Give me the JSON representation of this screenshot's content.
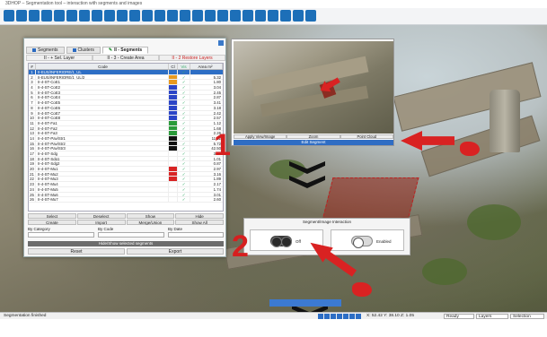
{
  "window": {
    "title": "3DHOP – Segmentation tool – interaction with segments and images"
  },
  "toolbar": {
    "icons": [
      "open-icon",
      "save-icon",
      "layers-icon",
      "folder-icon",
      "cube-icon",
      "target-icon",
      "gear-icon",
      "grid-icon",
      "image-icon",
      "person-icon",
      "lasso-icon",
      "table-icon",
      "pencil-icon",
      "eye-icon",
      "camera-icon",
      "measure-icon",
      "rotate-icon",
      "color-icon",
      "screenshot-icon",
      "palette-icon",
      "compare-icon",
      "brush-icon",
      "search-icon",
      "doc-icon",
      "play-icon"
    ]
  },
  "panel": {
    "tabs": [
      "Segments",
      "Clusters",
      "II - Segments"
    ],
    "subbar": [
      "II - + Sel. Layer",
      "II - 3 - Create Area",
      "II - 2  Restore Layers"
    ],
    "columns": [
      "#",
      "Code",
      "Cl",
      "Vis",
      "Area m²"
    ],
    "rows": [
      {
        "n": "1",
        "code": "II-EUS/INFERIORE/1_UL",
        "color": "#2d6ec5",
        "vis": "✓",
        "area": "",
        "selected": true
      },
      {
        "n": "2",
        "code": "II-EUS/INFERIORE/1_UL/2",
        "color": "#e89a1e",
        "vis": "✓",
        "area": "5.32"
      },
      {
        "n": "3",
        "code": "II-4-ST-CoE1",
        "color": "#e89a1e",
        "vis": "✓",
        "area": "1.80"
      },
      {
        "n": "4",
        "code": "II-4-ST-CoE2",
        "color": "#2b45c7",
        "vis": "✓",
        "area": "3.04"
      },
      {
        "n": "5",
        "code": "II-4-ST-CoE3",
        "color": "#2b45c7",
        "vis": "✓",
        "area": "2.45"
      },
      {
        "n": "6",
        "code": "II-4-ST-CoE4",
        "color": "#2b45c7",
        "vis": "✓",
        "area": "2.87"
      },
      {
        "n": "7",
        "code": "II-4-ST-CoE5",
        "color": "#2b45c7",
        "vis": "✓",
        "area": "3.41"
      },
      {
        "n": "8",
        "code": "II-4-ST-CoE6",
        "color": "#2b45c7",
        "vis": "✓",
        "area": "3.18"
      },
      {
        "n": "9",
        "code": "II-4-ST-CoE7",
        "color": "#2b45c7",
        "vis": "✓",
        "area": "2.42"
      },
      {
        "n": "10",
        "code": "II-4-ST-CoE8",
        "color": "#2b45c7",
        "vis": "✓",
        "area": "2.57"
      },
      {
        "n": "11",
        "code": "II-4-ST-Fa1",
        "color": "#2a9a3a",
        "vis": "✓",
        "area": "1.12"
      },
      {
        "n": "12",
        "code": "II-4-ST-Fa2",
        "color": "#2a9a3a",
        "vis": "✓",
        "area": "1.68"
      },
      {
        "n": "13",
        "code": "II-4-ST-Fa3",
        "color": "#2a9a3a",
        "vis": "✓",
        "area": "2.26"
      },
      {
        "n": "14",
        "code": "II-4-ST-Pav/Str1",
        "color": "#111111",
        "vis": "✓",
        "area": "11.32"
      },
      {
        "n": "15",
        "code": "II-4-ST-Pav/Str2",
        "color": "#111111",
        "vis": "✓",
        "area": "5.72"
      },
      {
        "n": "16",
        "code": "II-4-ST-Pav/Str3",
        "color": "#111111",
        "vis": "✓",
        "area": "42.50"
      },
      {
        "n": "17",
        "code": "II-4-ST-Sdg",
        "color": "#ffffff",
        "vis": "✓",
        "area": "3.02"
      },
      {
        "n": "18",
        "code": "II-4-ST-Sdg1",
        "color": "#ffffff",
        "vis": "✓",
        "area": "1.01"
      },
      {
        "n": "19",
        "code": "II-4-ST-Sdg2",
        "color": "#ffffff",
        "vis": "✓",
        "area": "0.87"
      },
      {
        "n": "20",
        "code": "II-4-ST-Mu1",
        "color": "#d82424",
        "vis": "✓",
        "area": "2.97"
      },
      {
        "n": "21",
        "code": "II-4-ST-Mu2",
        "color": "#d82424",
        "vis": "✓",
        "area": "3.16"
      },
      {
        "n": "22",
        "code": "II-4-ST-Mu3",
        "color": "#d82424",
        "vis": "✓",
        "area": "1.89"
      },
      {
        "n": "23",
        "code": "II-4-ST-Mu4",
        "color": "#ffffff",
        "vis": "✓",
        "area": "2.17"
      },
      {
        "n": "24",
        "code": "II-4-ST-Mu5",
        "color": "#ffffff",
        "vis": "✓",
        "area": "1.74"
      },
      {
        "n": "25",
        "code": "II-4-ST-Mu6",
        "color": "#ffffff",
        "vis": "✓",
        "area": "3.01"
      },
      {
        "n": "26",
        "code": "II-4-ST-Mu7",
        "color": "#ffffff",
        "vis": "✓",
        "area": "2.60"
      }
    ],
    "buttons": [
      "Select",
      "Deselect",
      "Show",
      "Hide",
      "Create",
      "Import",
      "Merge/Union",
      "Show All"
    ],
    "filter_labels": {
      "category": "By Category",
      "code": "By Code",
      "by_date": "By Date"
    },
    "wide_button": "Hide/Show selected segments",
    "bottom_buttons": [
      "Reset",
      "Export"
    ]
  },
  "viewer": {
    "buttons": [
      "Apply View/Image",
      "Zoom",
      "Point Cloud"
    ],
    "edit_button": "Edit Segment"
  },
  "dialog": {
    "title": "Segment/Image Interaction",
    "option_left": "Off",
    "option_right": "Enabled"
  },
  "annotations": {
    "step1": "1",
    "step2": "2"
  },
  "statusbar": {
    "left": "Segmentation finished",
    "coords": "X: 52.42  Y: 38.10  Z: 1.05",
    "box1": "Ready",
    "box2": "Layers",
    "box3": "Selection"
  }
}
